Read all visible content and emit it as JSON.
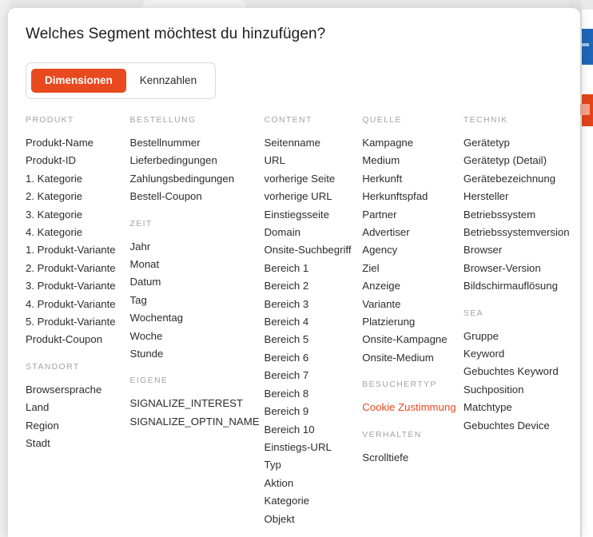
{
  "backdrop": {
    "strip_blue_color": "#1f66b8",
    "strip_orange_color": "#e2441a"
  },
  "modal": {
    "title": "Welches Segment möchtest du hinzufügen?",
    "tabs": [
      {
        "label": "Dimensionen",
        "active": true
      },
      {
        "label": "Kennzahlen",
        "active": false
      }
    ],
    "accent_color": "#e8491e",
    "columns": [
      {
        "name": "column-produkt",
        "groups": [
          {
            "title": "PRODUKT",
            "items": [
              {
                "label": "Produkt-Name"
              },
              {
                "label": "Produkt-ID"
              },
              {
                "label": "1. Kategorie"
              },
              {
                "label": "2. Kategorie"
              },
              {
                "label": "3. Kategorie"
              },
              {
                "label": "4. Kategorie"
              },
              {
                "label": "1. Produkt-Variante"
              },
              {
                "label": "2. Produkt-Variante"
              },
              {
                "label": "3. Produkt-Variante"
              },
              {
                "label": "4. Produkt-Variante"
              },
              {
                "label": "5. Produkt-Variante"
              },
              {
                "label": "Produkt-Coupon"
              }
            ]
          },
          {
            "title": "STANDORT",
            "items": [
              {
                "label": "Browsersprache"
              },
              {
                "label": "Land"
              },
              {
                "label": "Region"
              },
              {
                "label": "Stadt"
              }
            ]
          }
        ]
      },
      {
        "name": "column-bestellung",
        "groups": [
          {
            "title": "BESTELLUNG",
            "items": [
              {
                "label": "Bestellnummer"
              },
              {
                "label": "Lieferbedingungen"
              },
              {
                "label": "Zahlungsbedingungen"
              },
              {
                "label": "Bestell-Coupon"
              }
            ]
          },
          {
            "title": "ZEIT",
            "items": [
              {
                "label": "Jahr"
              },
              {
                "label": "Monat"
              },
              {
                "label": "Datum"
              },
              {
                "label": "Tag"
              },
              {
                "label": "Wochentag"
              },
              {
                "label": "Woche"
              },
              {
                "label": "Stunde"
              }
            ]
          },
          {
            "title": "EIGENE",
            "items": [
              {
                "label": "SIGNALIZE_INTEREST"
              },
              {
                "label": "SIGNALIZE_OPTIN_NAME"
              }
            ]
          }
        ]
      },
      {
        "name": "column-content",
        "groups": [
          {
            "title": "CONTENT",
            "items": [
              {
                "label": "Seitenname"
              },
              {
                "label": "URL"
              },
              {
                "label": "vorherige Seite"
              },
              {
                "label": "vorherige URL"
              },
              {
                "label": "Einstiegsseite"
              },
              {
                "label": "Domain"
              },
              {
                "label": "Onsite-Suchbegriff"
              },
              {
                "label": "Bereich 1"
              },
              {
                "label": "Bereich 2"
              },
              {
                "label": "Bereich 3"
              },
              {
                "label": "Bereich 4"
              },
              {
                "label": "Bereich 5"
              },
              {
                "label": "Bereich 6"
              },
              {
                "label": "Bereich 7"
              },
              {
                "label": "Bereich 8"
              },
              {
                "label": "Bereich 9"
              },
              {
                "label": "Bereich 10"
              },
              {
                "label": "Einstiegs-URL"
              },
              {
                "label": "Typ"
              },
              {
                "label": "Aktion"
              },
              {
                "label": "Kategorie"
              },
              {
                "label": "Objekt"
              }
            ]
          }
        ]
      },
      {
        "name": "column-quelle",
        "groups": [
          {
            "title": "QUELLE",
            "items": [
              {
                "label": "Kampagne"
              },
              {
                "label": "Medium"
              },
              {
                "label": "Herkunft"
              },
              {
                "label": "Herkunftspfad"
              },
              {
                "label": "Partner"
              },
              {
                "label": "Advertiser"
              },
              {
                "label": "Agency"
              },
              {
                "label": "Ziel"
              },
              {
                "label": "Anzeige"
              },
              {
                "label": "Variante"
              },
              {
                "label": "Platzierung"
              },
              {
                "label": "Onsite-Kampagne"
              },
              {
                "label": "Onsite-Medium"
              }
            ]
          },
          {
            "title": "BESUCHERTYP",
            "items": [
              {
                "label": "Cookie Zustimmung",
                "highlight": true
              }
            ]
          },
          {
            "title": "VERHALTEN",
            "items": [
              {
                "label": "Scrolltiefe"
              }
            ]
          }
        ]
      },
      {
        "name": "column-technik",
        "groups": [
          {
            "title": "TECHNIK",
            "items": [
              {
                "label": "Gerätetyp"
              },
              {
                "label": "Gerätetyp (Detail)"
              },
              {
                "label": "Gerätebezeichnung"
              },
              {
                "label": "Hersteller"
              },
              {
                "label": "Betriebssystem"
              },
              {
                "label": "Betriebssystemversion"
              },
              {
                "label": "Browser"
              },
              {
                "label": "Browser-Version"
              },
              {
                "label": "Bildschirmauflösung"
              }
            ]
          },
          {
            "title": "SEA",
            "items": [
              {
                "label": "Gruppe"
              },
              {
                "label": "Keyword"
              },
              {
                "label": "Gebuchtes Keyword"
              },
              {
                "label": "Suchposition"
              },
              {
                "label": "Matchtype"
              },
              {
                "label": "Gebuchtes Device"
              }
            ]
          }
        ]
      }
    ]
  }
}
